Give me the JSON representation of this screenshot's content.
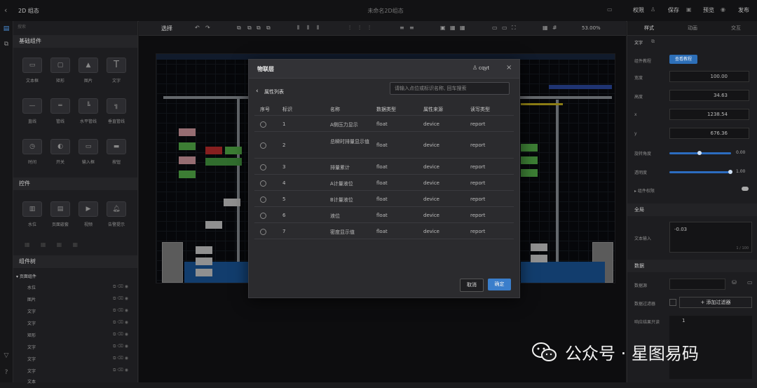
{
  "topbar": {
    "app_title": "2D 组态",
    "doc_title": "未命名2D组态",
    "controls": [
      "权限",
      "保存",
      "预览",
      "发布"
    ]
  },
  "left_panel": {
    "search_placeholder": "搜索",
    "basic_header": "基础组件",
    "basic_components": [
      {
        "label": "文本框",
        "icon": "text-box-icon"
      },
      {
        "label": "矩形",
        "icon": "rectangle-icon"
      },
      {
        "label": "图片",
        "icon": "image-icon"
      },
      {
        "label": "文字",
        "icon": "text-icon"
      },
      {
        "label": "直线",
        "icon": "line-icon"
      },
      {
        "label": "管线",
        "icon": "pipe-icon"
      },
      {
        "label": "水平管线",
        "icon": "horizontal-pipe-icon"
      },
      {
        "label": "垂直管线",
        "icon": "vertical-pipe-icon"
      },
      {
        "label": "时间",
        "icon": "clock-icon"
      },
      {
        "label": "开关",
        "icon": "switch-icon"
      },
      {
        "label": "输入框",
        "icon": "input-icon"
      },
      {
        "label": "按钮",
        "icon": "button-icon"
      }
    ],
    "controls_header": "控件",
    "control_components": [
      {
        "label": "水位",
        "icon": "water-level-icon"
      },
      {
        "label": "页面嵌套",
        "icon": "page-nest-icon"
      },
      {
        "label": "视频",
        "icon": "video-icon"
      },
      {
        "label": "告警提示",
        "icon": "alarm-icon"
      }
    ],
    "tree_header": "组件树",
    "tree_root": "页面组件",
    "tree_items": [
      "水位",
      "图片",
      "文字",
      "文字",
      "矩形",
      "文字",
      "文字",
      "文字",
      "文本"
    ]
  },
  "toolbar": {
    "select_label": "选择",
    "zoom": "53.00%"
  },
  "modal": {
    "title": "物联层",
    "user": "cqyt",
    "subtitle": "属性列表",
    "search_placeholder": "请输入点位或标识名称, 回车搜索",
    "columns": [
      "序号",
      "标识",
      "名称",
      "数据类型",
      "属性来源",
      "读写类型"
    ],
    "rows": [
      {
        "id": "1",
        "name": "A侧压力显示",
        "type": "float",
        "source": "device",
        "rw": "report"
      },
      {
        "id": "2",
        "name": "总瞬时排量显示值",
        "type": "float",
        "source": "device",
        "rw": "report"
      },
      {
        "id": "3",
        "name": "排量累计",
        "type": "float",
        "source": "device",
        "rw": "report"
      },
      {
        "id": "4",
        "name": "A计量液位",
        "type": "float",
        "source": "device",
        "rw": "report"
      },
      {
        "id": "5",
        "name": "B计量液位",
        "type": "float",
        "source": "device",
        "rw": "report"
      },
      {
        "id": "6",
        "name": "液位",
        "type": "float",
        "source": "device",
        "rw": "report"
      },
      {
        "id": "7",
        "name": "密度显示值",
        "type": "float",
        "source": "device",
        "rw": "report"
      }
    ],
    "cancel_label": "取消",
    "ok_label": "确定"
  },
  "right_panel": {
    "tabs": [
      "样式",
      "动画",
      "交互"
    ],
    "section_text": "文字",
    "component_tutorial_label": "组件教程",
    "view_tutorial_btn": "查看教程",
    "fields": [
      {
        "label": "宽度",
        "value": "100.00"
      },
      {
        "label": "高度",
        "value": "34.63"
      },
      {
        "label": "x",
        "value": "1238.54"
      },
      {
        "label": "y",
        "value": "676.36"
      }
    ],
    "rotation_label": "旋转角度",
    "rotation_value": "0.00",
    "opacity_label": "透明度",
    "opacity_value": "1.00",
    "permission_label": "组件权限",
    "global_header": "全局",
    "text_input_label": "文本输入",
    "text_input_value": "-0.03",
    "text_counter": "1 / 100",
    "data_header": "数据",
    "datasource_label": "数据源",
    "filter_label": "数据过滤器",
    "add_filter_btn": "+ 添加过滤器",
    "response_label": "响应结果只读",
    "response_value": "1"
  },
  "watermark": "公众号 · 星图易码"
}
